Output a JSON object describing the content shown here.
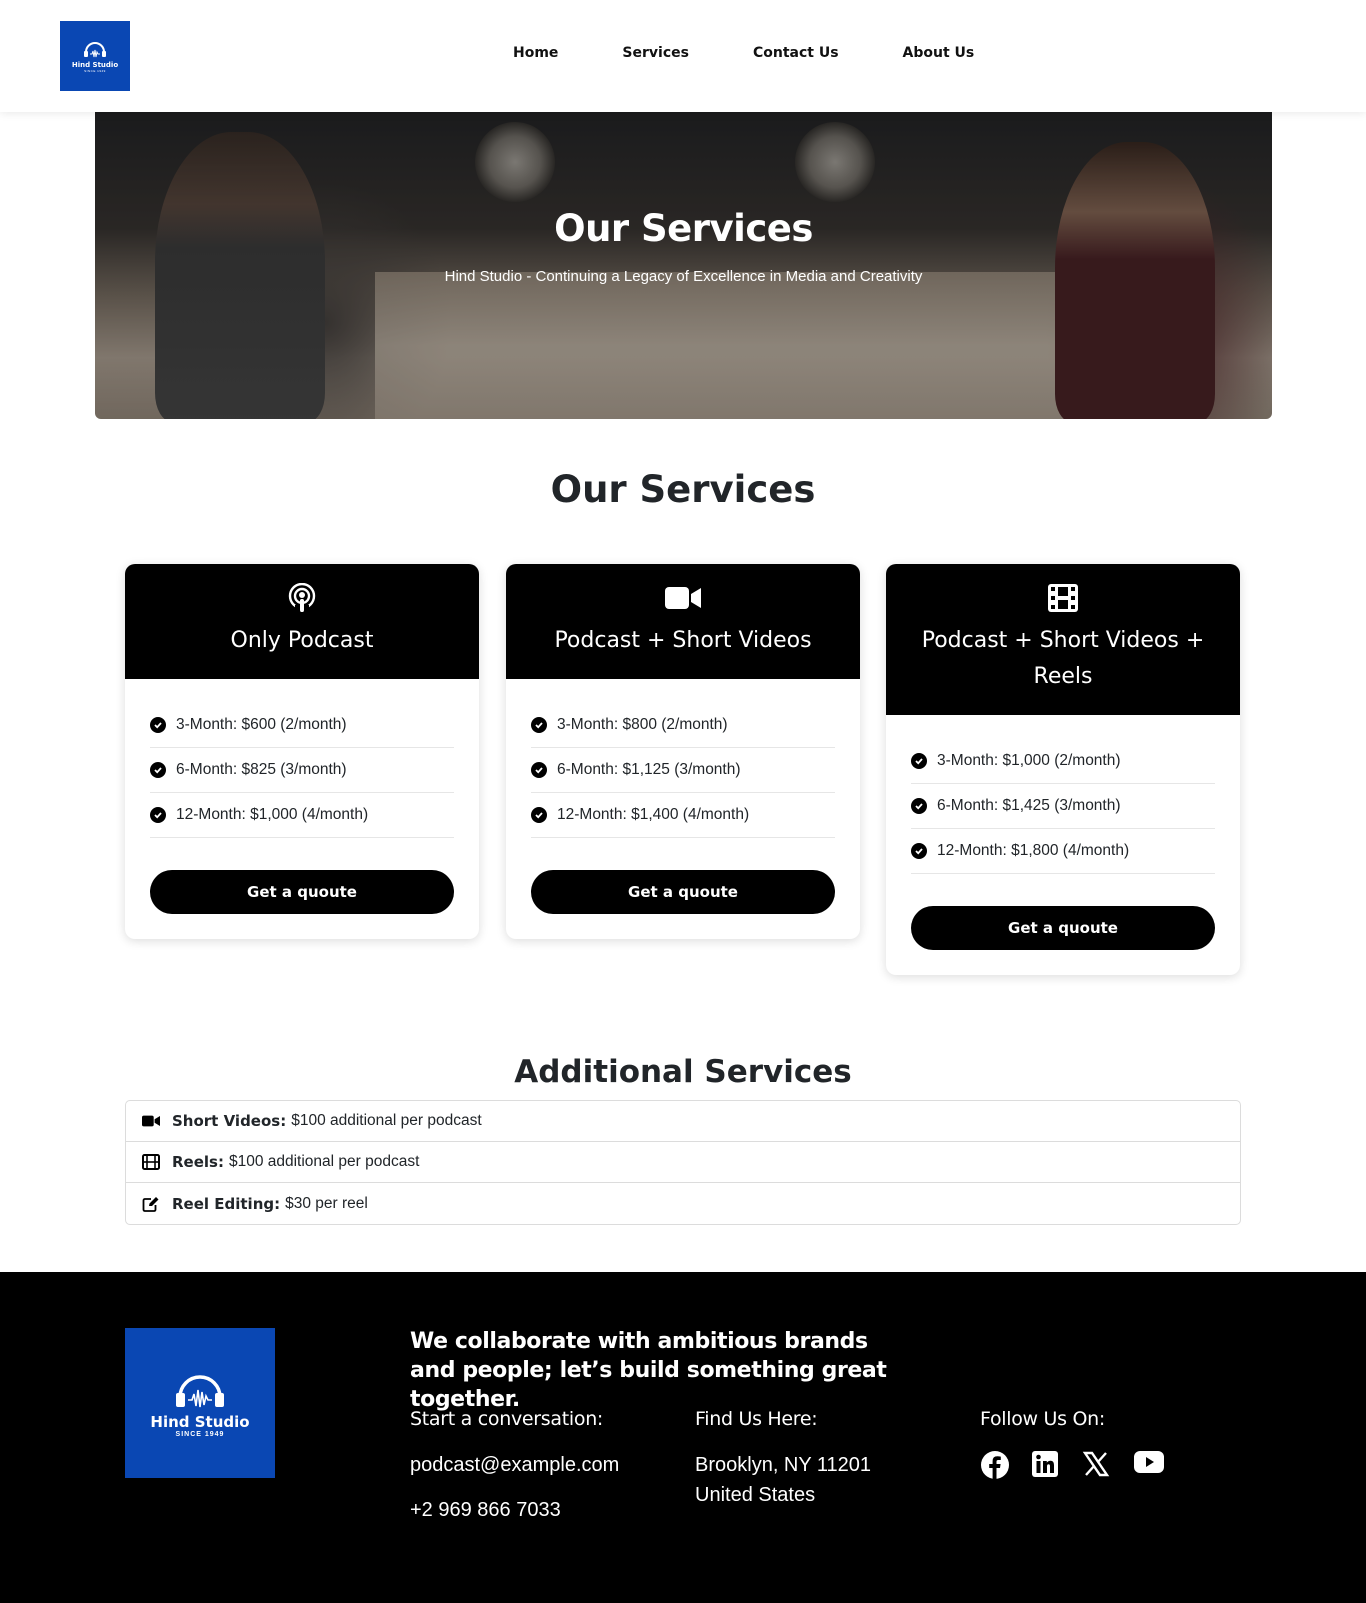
{
  "nav": {
    "logo_title": "Hind Studio",
    "logo_subtitle": "SINCE 1949",
    "items": [
      "Home",
      "Services",
      "Contact Us",
      "About Us"
    ]
  },
  "hero": {
    "title": "Our Services",
    "subtitle": "Hind Studio - Continuing a Legacy of Excellence in Media and Creativity"
  },
  "services": {
    "title": "Our Services",
    "cards": [
      {
        "icon": "podcast-icon",
        "title": "Only Podcast",
        "items": [
          "3-Month: $600 (2/month)",
          "6-Month: $825 (3/month)",
          "12-Month: $1,000 (4/month)"
        ],
        "button": "Get a quoute"
      },
      {
        "icon": "video-camera-icon",
        "title": "Podcast + Short Videos",
        "items": [
          "3-Month: $800 (2/month)",
          "6-Month: $1,125 (3/month)",
          "12-Month: $1,400 (4/month)"
        ],
        "button": "Get a quoute"
      },
      {
        "icon": "film-icon",
        "title": "Podcast + Short Videos + Reels",
        "items": [
          "3-Month: $1,000 (2/month)",
          "6-Month: $1,425 (3/month)",
          "12-Month: $1,800 (4/month)"
        ],
        "button": "Get a quoute"
      }
    ]
  },
  "additional": {
    "title": "Additional Services",
    "items": [
      {
        "icon": "video-camera-icon",
        "label": "Short Videos:",
        "text": "$100 additional per podcast"
      },
      {
        "icon": "film-icon",
        "label": "Reels:",
        "text": "$100 additional per podcast"
      },
      {
        "icon": "edit-icon",
        "label": "Reel Editing:",
        "text": "$30 per reel"
      }
    ]
  },
  "footer": {
    "logo_title": "Hind Studio",
    "logo_subtitle": "SINCE 1949",
    "tagline": "We collaborate with ambitious brands and people; let’s build something great together.",
    "contact": {
      "heading": "Start a conversation:",
      "email": "podcast@example.com",
      "phone": "+2 969 866 7033"
    },
    "location": {
      "heading": "Find Us Here:",
      "line1": "Brooklyn, NY 11201",
      "line2": "United States"
    },
    "social": {
      "heading": "Follow Us On:",
      "icons": [
        "facebook-icon",
        "linkedin-icon",
        "x-icon",
        "youtube-icon"
      ]
    }
  },
  "colors": {
    "brand_blue": "#0a47b3",
    "black": "#000000"
  }
}
